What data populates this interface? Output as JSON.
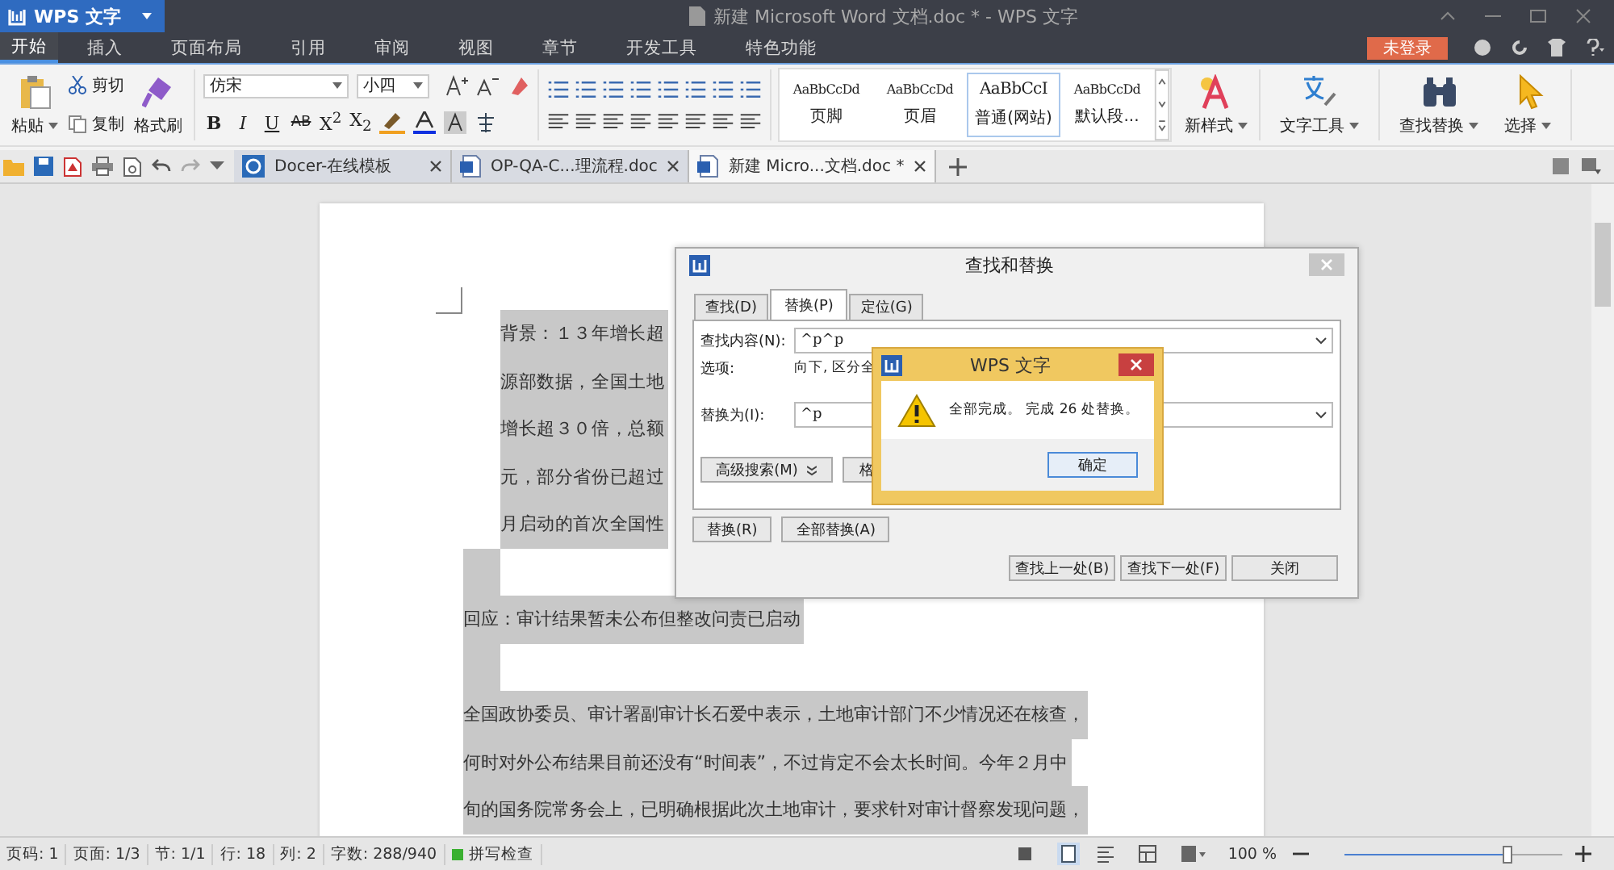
{
  "window": {
    "app_button": "WPS 文字",
    "title": "新建 Microsoft Word 文档.doc * - WPS 文字",
    "login_button": "未登录"
  },
  "menu_tabs": [
    {
      "label": "开始",
      "selected": true
    },
    {
      "label": "插入",
      "selected": false
    },
    {
      "label": "页面布局",
      "selected": false
    },
    {
      "label": "引用",
      "selected": false
    },
    {
      "label": "审阅",
      "selected": false
    },
    {
      "label": "视图",
      "selected": false
    },
    {
      "label": "章节",
      "selected": false
    },
    {
      "label": "开发工具",
      "selected": false
    },
    {
      "label": "特色功能",
      "selected": false
    }
  ],
  "ribbon": {
    "paste": "粘贴",
    "cut": "剪切",
    "copy": "复制",
    "format_painter": "格式刷",
    "font_family": "仿宋",
    "font_size": "小四",
    "bold": "B",
    "italic": "I",
    "underline": "U",
    "strike": "AB",
    "superscript": "X$^{2}$",
    "subscript": "X$_{2}$",
    "styles": [
      {
        "preview": "AaBbCcDd",
        "name": "页脚",
        "selected": false
      },
      {
        "preview": "AaBbCcDd",
        "name": "页眉",
        "selected": false
      },
      {
        "preview": "AaBbCcI",
        "name": "普通(网站)",
        "selected": true
      },
      {
        "preview": "AaBbCcDd",
        "name": "默认段...",
        "selected": false
      }
    ],
    "new_style": "新样式",
    "text_tools": "文字工具",
    "find_replace": "查找替换",
    "select": "选择"
  },
  "doc_tabs": [
    {
      "label": "Docer-在线模板",
      "selected": false,
      "kind": "docer"
    },
    {
      "label": "OP-QA-C...理流程.doc",
      "selected": false,
      "kind": "doc"
    },
    {
      "label": "新建 Micro...文档.doc *",
      "selected": true,
      "kind": "doc"
    }
  ],
  "document": {
    "lines": [
      {
        "kind": "indented",
        "text": "背景：１３年增长超",
        "selected": true
      },
      {
        "kind": "indented",
        "text": "源部数据，全国土地",
        "selected": true
      },
      {
        "kind": "indented",
        "text": "增长超３０倍，总额",
        "selected": true
      },
      {
        "kind": "indented",
        "text": "元，部分省份已超过",
        "selected": true
      },
      {
        "kind": "indented",
        "text": "月启动的首次全国性",
        "selected": true
      },
      {
        "kind": "empty",
        "selected": true
      },
      {
        "kind": "plain",
        "text": "回应：审计结果暂未公布但整改问责已启动",
        "selected": true
      },
      {
        "kind": "empty",
        "selected": true
      },
      {
        "kind": "plain",
        "text": "全国政协委员、审计署副审计长石爱中表示，土地审计部门不少情况还在核查，",
        "selected": true
      },
      {
        "kind": "plain",
        "text": "何时对外公布结果目前还没有“时间表”，不过肯定不会太长时间。今年２月中",
        "selected": true
      },
      {
        "kind": "plain",
        "text": "旬的国务院常务会上，已明确根据此次土地审计，要求针对审计督察发现问题，",
        "selected": true
      }
    ]
  },
  "find_dialog": {
    "title": "查找和替换",
    "tabs": [
      {
        "label": "查找(D)",
        "selected": false
      },
      {
        "label": "替换(P)",
        "selected": true
      },
      {
        "label": "定位(G)",
        "selected": false
      }
    ],
    "find_label": "查找内容(N):",
    "find_value": "^p^p",
    "options_label": "选项:",
    "options_value": "向下, 区分全",
    "replace_label": "替换为(I):",
    "replace_value": "^p",
    "advanced_button": "高级搜索(M)",
    "format_button": "格",
    "replace_button": "替换(R)",
    "replace_all_button": "全部替换(A)",
    "prev_button": "查找上一处(B)",
    "next_button": "查找下一处(F)",
    "close_button": "关闭"
  },
  "message_box": {
    "title": "WPS 文字",
    "text": "全部完成。 完成 26 处替换。",
    "ok_button": "确定"
  },
  "status_bar": {
    "items": [
      "页码: 1",
      "页面: 1/3",
      "节: 1/1",
      "行: 18",
      "列: 2",
      "字数: 288/940"
    ],
    "spell_check": "拼写检查",
    "zoom": "100 %",
    "zoom_slider": {
      "level": 0.75
    }
  }
}
